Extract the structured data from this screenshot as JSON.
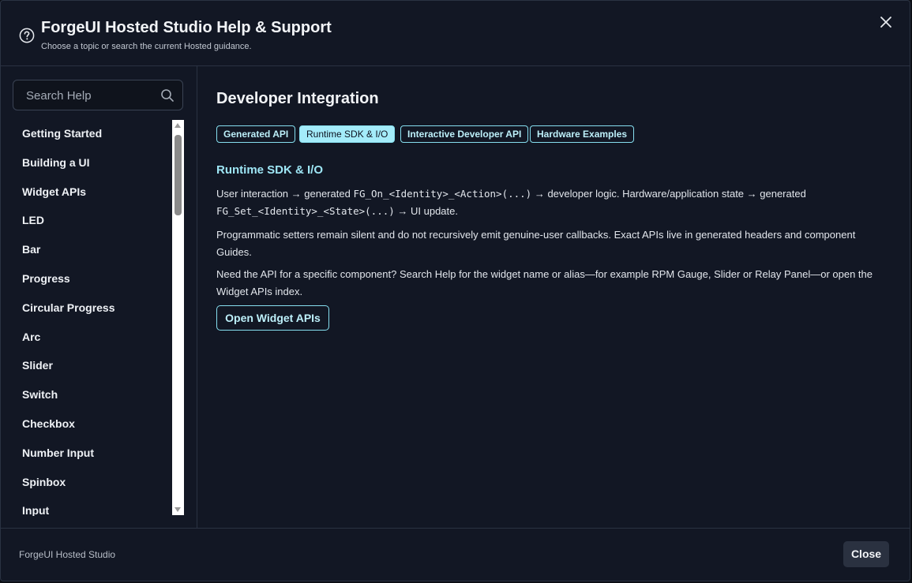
{
  "header": {
    "title": "ForgeUI Hosted Studio Help & Support",
    "subtitle": "Choose a topic or search the current Hosted guidance."
  },
  "sidebar": {
    "search_placeholder": "Search Help",
    "items": [
      {
        "label": "Getting Started"
      },
      {
        "label": "Building a UI"
      },
      {
        "label": "Widget APIs"
      },
      {
        "label": "LED"
      },
      {
        "label": "Bar"
      },
      {
        "label": "Progress"
      },
      {
        "label": "Circular Progress"
      },
      {
        "label": "Arc"
      },
      {
        "label": "Slider"
      },
      {
        "label": "Switch"
      },
      {
        "label": "Checkbox"
      },
      {
        "label": "Number Input"
      },
      {
        "label": "Spinbox"
      },
      {
        "label": "Input"
      }
    ]
  },
  "main": {
    "title": "Developer Integration",
    "chips": [
      {
        "label": "Generated API",
        "active": false
      },
      {
        "label": "Runtime SDK & I/O",
        "active": true
      },
      {
        "label": "Interactive Developer API",
        "active": false
      },
      {
        "label": "Hardware Examples",
        "active": false
      }
    ],
    "section_title": "Runtime SDK & I/O",
    "para1": {
      "a": "User interaction → generated ",
      "code1": "FG_On_<Identity>_<Action>(...)",
      "b": " → developer logic. Hardware/application state → generated ",
      "code2": "FG_Set_<Identity>_<State>(...)",
      "c": " → UI update."
    },
    "para2": "Programmatic setters remain silent and do not recursively emit genuine-user callbacks. Exact APIs live in generated headers and component Guides.",
    "para3": "Need the API for a specific component? Search Help for the widget name or alias—for example RPM Gauge, Slider or Relay Panel—or open the Widget APIs index.",
    "open_button": "Open Widget APIs"
  },
  "footer": {
    "label": "ForgeUI Hosted Studio",
    "close_button": "Close"
  }
}
